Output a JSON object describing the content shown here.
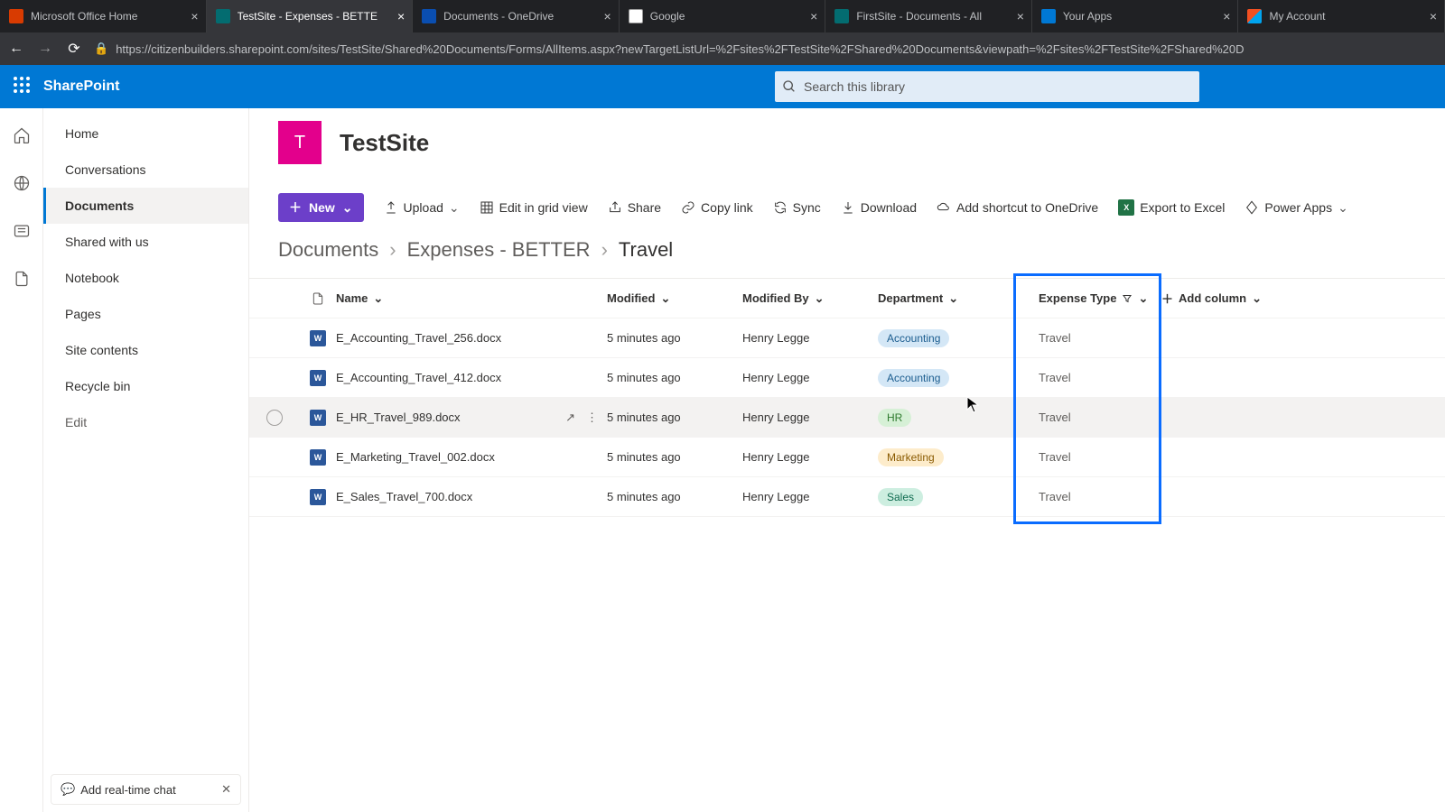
{
  "browser": {
    "tabs": [
      {
        "title": "Microsoft Office Home",
        "fav": "fav-office"
      },
      {
        "title": "TestSite - Expenses - BETTE",
        "fav": "fav-sp",
        "active": true
      },
      {
        "title": "Documents - OneDrive",
        "fav": "fav-od"
      },
      {
        "title": "Google",
        "fav": "fav-g"
      },
      {
        "title": "FirstSite - Documents - All",
        "fav": "fav-sp"
      },
      {
        "title": "Your Apps",
        "fav": "fav-ya"
      },
      {
        "title": "My Account",
        "fav": "fav-ma"
      }
    ],
    "url": "https://citizenbuilders.sharepoint.com/sites/TestSite/Shared%20Documents/Forms/AllItems.aspx?newTargetListUrl=%2Fsites%2FTestSite%2FShared%20Documents&viewpath=%2Fsites%2FTestSite%2FShared%20D"
  },
  "suite": {
    "brand": "SharePoint",
    "search_placeholder": "Search this library"
  },
  "site": {
    "logo_initial": "T",
    "title": "TestSite"
  },
  "leftnav": {
    "items": [
      "Home",
      "Conversations",
      "Documents",
      "Shared with us",
      "Notebook",
      "Pages",
      "Site contents",
      "Recycle bin"
    ],
    "edit": "Edit",
    "activeIndex": 2,
    "chat_callout": "Add real-time chat"
  },
  "commands": {
    "new": "New",
    "upload": "Upload",
    "edit_grid": "Edit in grid view",
    "share": "Share",
    "copy_link": "Copy link",
    "sync": "Sync",
    "download": "Download",
    "add_shortcut": "Add shortcut to OneDrive",
    "export_excel": "Export to Excel",
    "power_apps": "Power Apps"
  },
  "breadcrumb": {
    "root": "Documents",
    "mid": "Expenses - BETTER",
    "current": "Travel"
  },
  "columns": {
    "name": "Name",
    "modified": "Modified",
    "modified_by": "Modified By",
    "department": "Department",
    "expense_type": "Expense Type",
    "add_column": "Add column"
  },
  "rows": [
    {
      "name": "E_Accounting_Travel_256.docx",
      "modified": "5 minutes ago",
      "by": "Henry Legge",
      "dept": "Accounting",
      "dept_class": "pill-accounting",
      "type": "Travel"
    },
    {
      "name": "E_Accounting_Travel_412.docx",
      "modified": "5 minutes ago",
      "by": "Henry Legge",
      "dept": "Accounting",
      "dept_class": "pill-accounting",
      "type": "Travel"
    },
    {
      "name": "E_HR_Travel_989.docx",
      "modified": "5 minutes ago",
      "by": "Henry Legge",
      "dept": "HR",
      "dept_class": "pill-hr",
      "type": "Travel",
      "hover": true
    },
    {
      "name": "E_Marketing_Travel_002.docx",
      "modified": "5 minutes ago",
      "by": "Henry Legge",
      "dept": "Marketing",
      "dept_class": "pill-marketing",
      "type": "Travel"
    },
    {
      "name": "E_Sales_Travel_700.docx",
      "modified": "5 minutes ago",
      "by": "Henry Legge",
      "dept": "Sales",
      "dept_class": "pill-sales",
      "type": "Travel"
    }
  ]
}
